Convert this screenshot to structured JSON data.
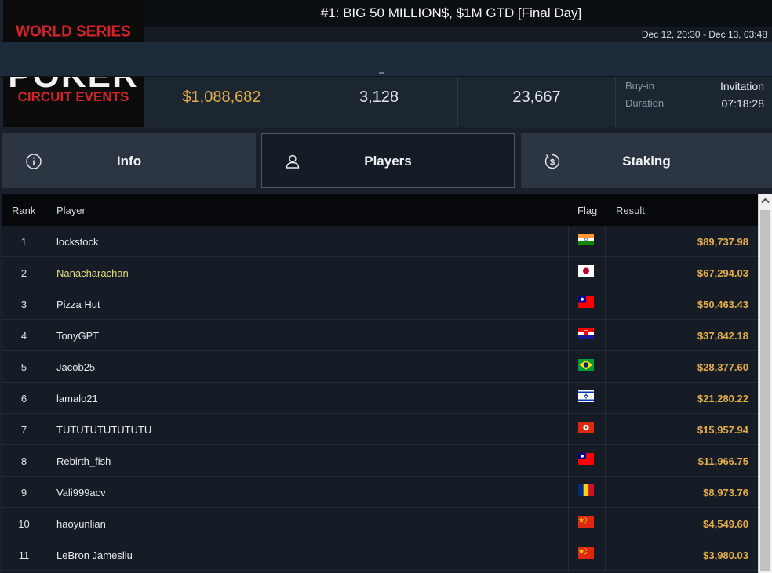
{
  "logo": {
    "line1": "WORLD SERIES",
    "line2": "POKER",
    "line3": "CIRCUIT EVENTS"
  },
  "tournament": {
    "title": "#1: BIG 50 MILLION$, $1M GTD [Final Day]",
    "dates": "Dec 12, 20:30 - Dec 13, 03:48"
  },
  "stats": {
    "prize_pool": "$1,088,682",
    "entries": "3,128",
    "third": "23,667",
    "buyin_label": "Buy-in",
    "buyin_value": "Invitation",
    "duration_label": "Duration",
    "duration_value": "07:18:28"
  },
  "tabs": [
    {
      "label": "Info",
      "icon": "info-icon"
    },
    {
      "label": "Players",
      "icon": "user-icon",
      "active": true
    },
    {
      "label": "Staking",
      "icon": "dollar-cycle-icon"
    }
  ],
  "table": {
    "headers": {
      "rank": "Rank",
      "player": "Player",
      "flag": "Flag",
      "result": "Result"
    },
    "rows": [
      {
        "rank": "1",
        "player": "lockstock",
        "flag": "india",
        "result": "$89,737.98"
      },
      {
        "rank": "2",
        "player": "Nanacharachan",
        "flag": "japan",
        "result": "$67,294.03",
        "highlight": true
      },
      {
        "rank": "3",
        "player": "Pizza Hut",
        "flag": "taiwan",
        "result": "$50,463.43"
      },
      {
        "rank": "4",
        "player": "TonyGPT",
        "flag": "croatia",
        "result": "$37,842.18"
      },
      {
        "rank": "5",
        "player": "Jacob25",
        "flag": "brazil",
        "result": "$28,377.60"
      },
      {
        "rank": "6",
        "player": "lamalo21",
        "flag": "israel",
        "result": "$21,280.22"
      },
      {
        "rank": "7",
        "player": "TUTUTUTUTUTUTU",
        "flag": "hong-kong",
        "result": "$15,957.94"
      },
      {
        "rank": "8",
        "player": "Rebirth_fish",
        "flag": "taiwan",
        "result": "$11,966.75"
      },
      {
        "rank": "9",
        "player": "Vali999acv",
        "flag": "romania",
        "result": "$8,973.76"
      },
      {
        "rank": "10",
        "player": "haoyunlian",
        "flag": "china",
        "result": "$4,549.60"
      },
      {
        "rank": "11",
        "player": "LeBron Jamesliu",
        "flag": "china",
        "result": "$3,980.03"
      }
    ]
  },
  "colors": {
    "accent_gold": "#e3ad4b",
    "highlight_name": "#e3dc7a",
    "background": "#1a212b"
  }
}
